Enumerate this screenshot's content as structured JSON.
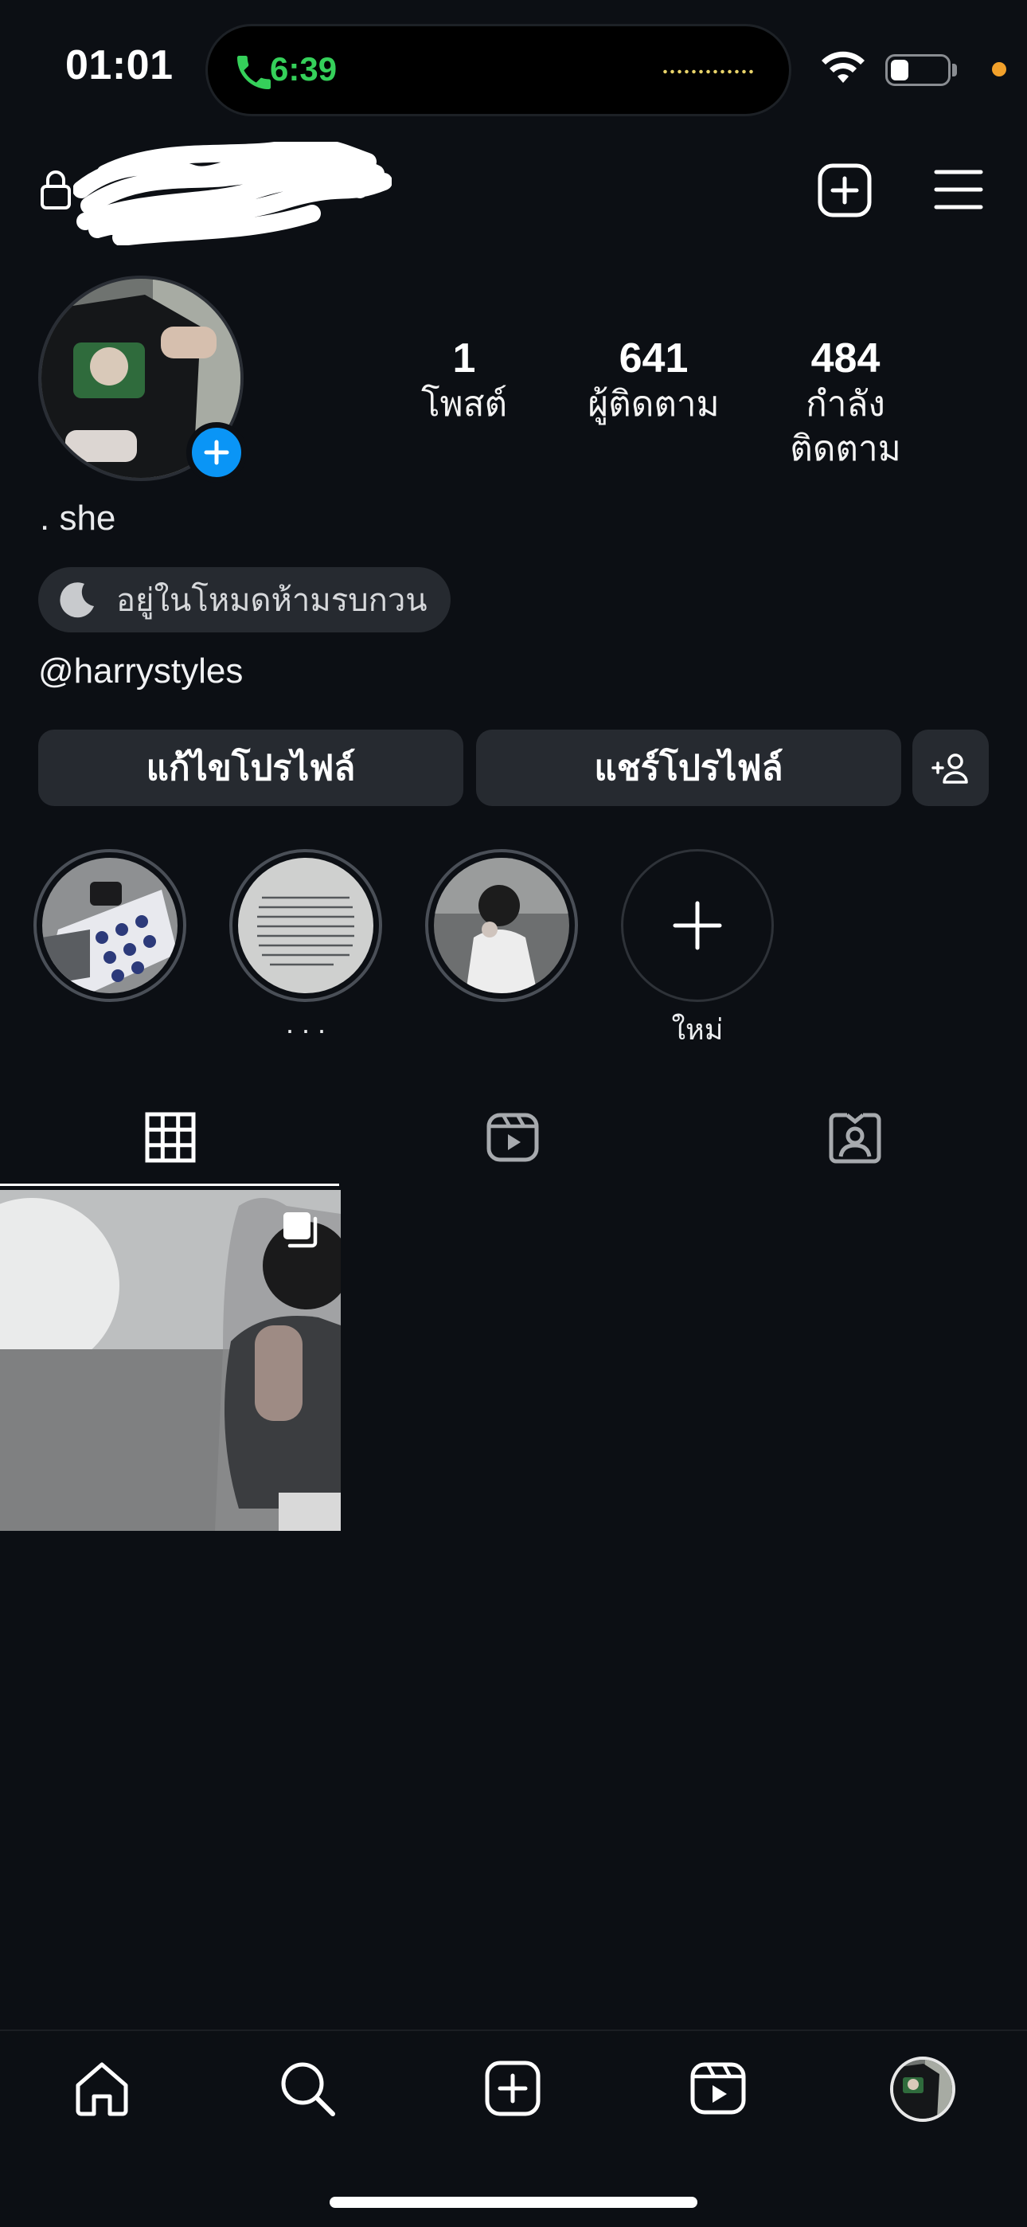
{
  "status_bar": {
    "time": "01:01",
    "call_time": "6:39",
    "icons": [
      "phone-icon",
      "wifi-icon",
      "battery-icon"
    ],
    "colors": {
      "call_green": "#35d05a",
      "privacy_dot": "#f2a12b"
    }
  },
  "header": {
    "icons": [
      "lock-icon",
      "create-post-icon",
      "menu-icon"
    ]
  },
  "profile": {
    "stats": [
      {
        "value": "1",
        "label": "โพสต์"
      },
      {
        "value": "641",
        "label": "ผู้ติดตาม"
      },
      {
        "value": "484",
        "label": "กำลังติดตาม"
      }
    ],
    "name": ". she",
    "status_pill": "อยู่ในโหมดห้ามรบกวน",
    "handle": "@harrystyles"
  },
  "actions": {
    "edit_profile": "แก้ไขโปรไฟล์",
    "share_profile": "แชร์โปรไฟล์",
    "discover_icon": "add-person-icon"
  },
  "highlights": [
    {
      "label": ""
    },
    {
      "label": ". . ."
    },
    {
      "label": ""
    },
    {
      "label": "ใหม่"
    }
  ],
  "tabs": [
    {
      "icon": "grid-icon",
      "active": true
    },
    {
      "icon": "reels-icon",
      "active": false
    },
    {
      "icon": "tagged-icon",
      "active": false
    }
  ],
  "posts": [
    {
      "type": "carousel",
      "icon": "multiple-photos-icon"
    }
  ],
  "bottom_nav": {
    "items": [
      "home-icon",
      "search-icon",
      "create-icon",
      "reels-icon",
      "profile-avatar"
    ]
  },
  "colors": {
    "background": "#0c0f14",
    "button_bg": "#262a30",
    "accent_blue": "#0a95f6"
  }
}
